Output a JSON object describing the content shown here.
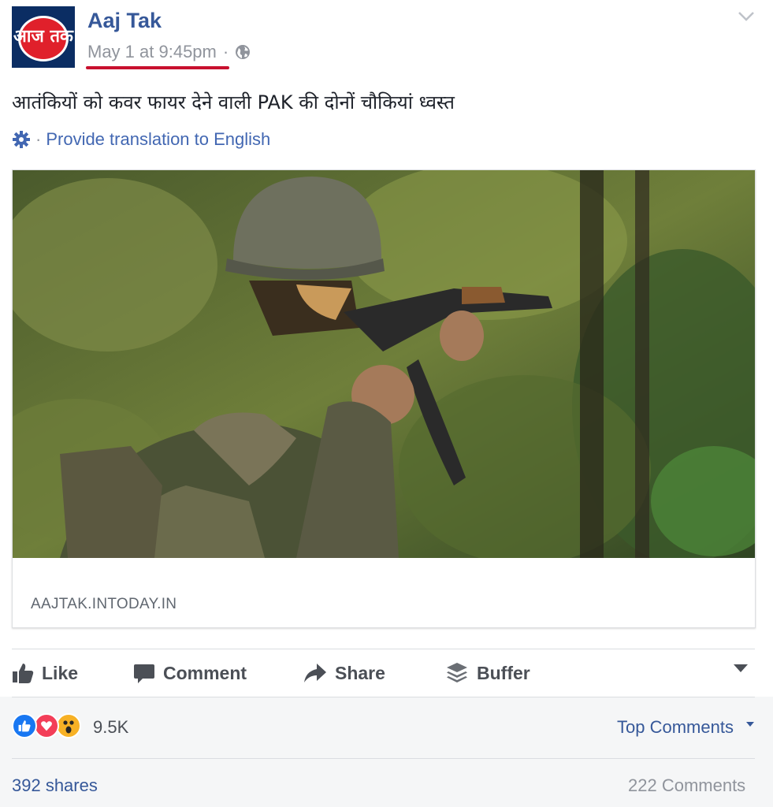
{
  "post": {
    "page_name": "Aaj Tak",
    "timestamp": "May 1 at 9:45pm",
    "separator": "·",
    "avatar_logo_text": "आज तक",
    "text": "आतंकियों को कवर फायर देने वाली PAK की दोनों चौकियां ध्वस्त",
    "translate_separator": "·",
    "translate_link": "Provide translation to English",
    "icons": {
      "privacy": "globe-icon",
      "options": "chevron-down-icon",
      "translate": "gear-icon"
    }
  },
  "link_card": {
    "domain": "AAJTAK.INTODAY.IN",
    "image": "soldier-with-rifle-in-forest"
  },
  "actions": [
    {
      "label": "Like",
      "icon": "thumbs-up-icon"
    },
    {
      "label": "Comment",
      "icon": "comment-icon"
    },
    {
      "label": "Share",
      "icon": "share-arrow-icon"
    },
    {
      "label": "Buffer",
      "icon": "buffer-stack-icon"
    }
  ],
  "footer": {
    "reactions": [
      "like",
      "love",
      "wow"
    ],
    "reaction_count": "9.5K",
    "top_comments": "Top Comments",
    "shares": "392 shares",
    "comments": "222 Comments"
  },
  "colors": {
    "link_blue": "#365899",
    "accent_blue": "#4267b2",
    "muted_gray": "#90949c",
    "like_blue": "#1877f2",
    "love_red": "#f33e58",
    "wow_yellow": "#f7b125",
    "underline_red": "#c8102e"
  }
}
